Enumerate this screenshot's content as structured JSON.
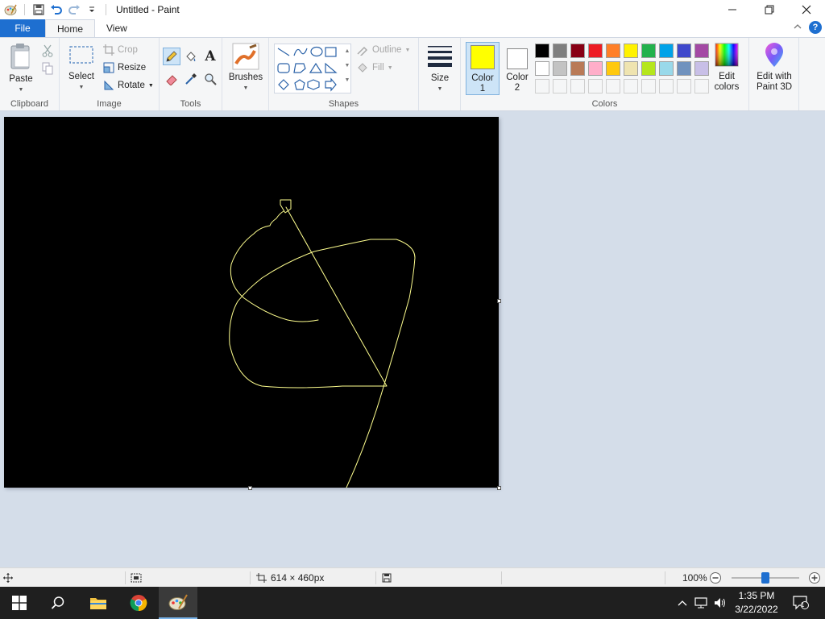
{
  "window": {
    "title": "Untitled - Paint"
  },
  "tabs": {
    "file": "File",
    "home": "Home",
    "view": "View"
  },
  "ribbon": {
    "clipboard": {
      "paste_label": "Paste",
      "group_label": "Clipboard"
    },
    "image": {
      "select_label": "Select",
      "crop_label": "Crop",
      "resize_label": "Resize",
      "rotate_label": "Rotate",
      "group_label": "Image"
    },
    "tools": {
      "group_label": "Tools"
    },
    "brushes": {
      "label": "Brushes"
    },
    "shapes": {
      "outline_label": "Outline",
      "fill_label": "Fill",
      "group_label": "Shapes"
    },
    "size": {
      "label": "Size"
    },
    "colors": {
      "color1_line1": "Color",
      "color1_line2": "1",
      "color2_line1": "Color",
      "color2_line2": "2",
      "color1_value": "#ffff00",
      "color2_value": "#ffffff",
      "edit_colors_line1": "Edit",
      "edit_colors_line2": "colors",
      "group_label": "Colors",
      "palette_row1": [
        "#000000",
        "#7f7f7f",
        "#880015",
        "#ed1c24",
        "#ff7f27",
        "#fff200",
        "#22b14c",
        "#00a2e8",
        "#3f48cc",
        "#a349a4"
      ],
      "palette_row2": [
        "#ffffff",
        "#c3c3c3",
        "#b97a57",
        "#ffaec9",
        "#ffc90e",
        "#efe4b0",
        "#b5e61d",
        "#99d9ea",
        "#7092be",
        "#c8bfe7"
      ]
    },
    "paint3d": {
      "line1": "Edit with",
      "line2": "Paint 3D"
    }
  },
  "canvas": {
    "background": "#000000",
    "stroke_color": "#ffff8f"
  },
  "status": {
    "dimensions": "614 × 460px",
    "zoom": "100%",
    "zoom_level": 0.5
  },
  "taskbar": {
    "time": "1:35 PM",
    "date": "3/22/2022",
    "notification_count": "1"
  }
}
